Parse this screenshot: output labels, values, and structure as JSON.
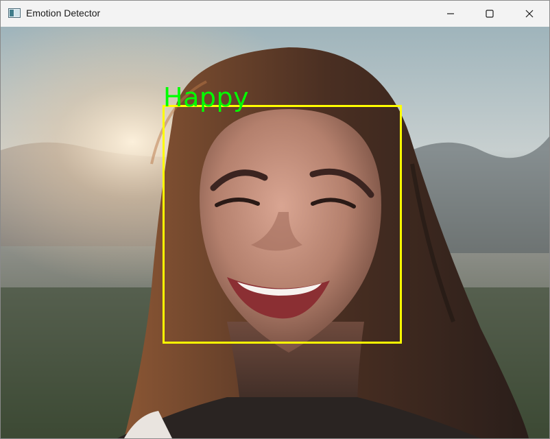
{
  "window": {
    "title": "Emotion Detector"
  },
  "controls": {
    "minimize_icon": "minimize-icon",
    "maximize_icon": "maximize-icon",
    "close_icon": "close-icon"
  },
  "detection": {
    "emotion_label": "Happy",
    "label_color": "#00ff00",
    "box_color": "#ffff00"
  }
}
